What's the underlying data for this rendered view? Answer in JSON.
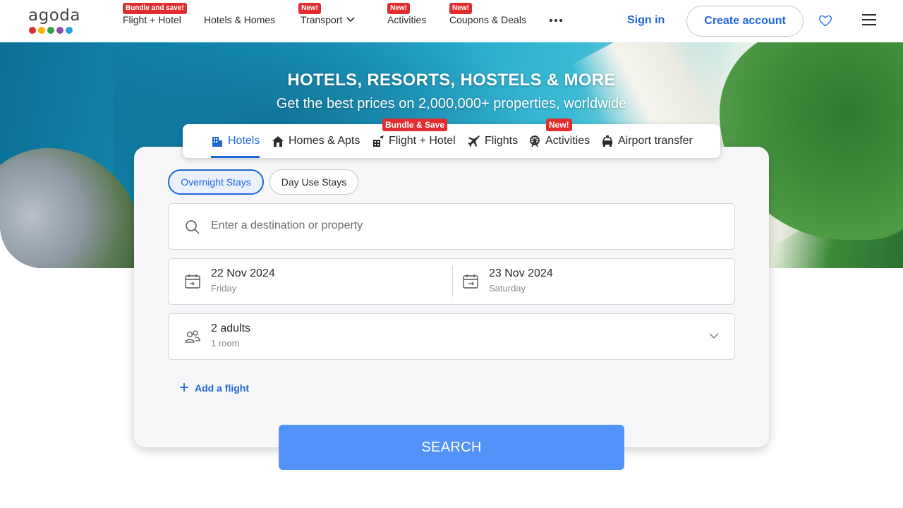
{
  "brand": {
    "logo_text": "agoda",
    "dot_colors": [
      "#e12d2d",
      "#f5b400",
      "#31a24c",
      "#8b4fa8",
      "#2a9fd6"
    ]
  },
  "header": {
    "nav": [
      {
        "label": "Flight + Hotel",
        "badge": "Bundle and save!"
      },
      {
        "label": "Hotels & Homes",
        "badge": ""
      },
      {
        "label": "Transport",
        "badge": "New!"
      },
      {
        "label": "Activities",
        "badge": "New!"
      },
      {
        "label": "Coupons & Deals",
        "badge": "New!"
      }
    ],
    "sign_in": "Sign in",
    "create_account": "Create account",
    "icons": [
      "more-icon",
      "heart-icon",
      "menu-icon"
    ]
  },
  "hero": {
    "title": "HOTELS, RESORTS, HOSTELS & MORE",
    "subtitle": "Get the best prices on 2,000,000+ properties, worldwide"
  },
  "tabs": [
    {
      "label": "Hotels",
      "icon": "hotel-icon",
      "active": true,
      "badge": ""
    },
    {
      "label": "Homes & Apts",
      "icon": "home-icon",
      "active": false,
      "badge": ""
    },
    {
      "label": "Flight + Hotel",
      "icon": "flight-hotel-icon",
      "active": false,
      "badge": "Bundle & Save"
    },
    {
      "label": "Flights",
      "icon": "plane-icon",
      "active": false,
      "badge": ""
    },
    {
      "label": "Activities",
      "icon": "ferris-wheel-icon",
      "active": false,
      "badge": "New!"
    },
    {
      "label": "Airport transfer",
      "icon": "car-icon",
      "active": false,
      "badge": ""
    }
  ],
  "stay_type": {
    "options": [
      "Overnight Stays",
      "Day Use Stays"
    ],
    "selected": "Overnight Stays"
  },
  "search": {
    "destination_placeholder": "Enter a destination or property",
    "check_in": {
      "date": "22 Nov 2024",
      "day": "Friday"
    },
    "check_out": {
      "date": "23 Nov 2024",
      "day": "Saturday"
    },
    "occupancy": {
      "guests": "2 adults",
      "rooms": "1 room"
    },
    "add_flight": "Add a flight",
    "button": "SEARCH"
  },
  "colors": {
    "accent": "#2067da",
    "search_button": "#5392f9",
    "badge": "#e12d2d"
  }
}
